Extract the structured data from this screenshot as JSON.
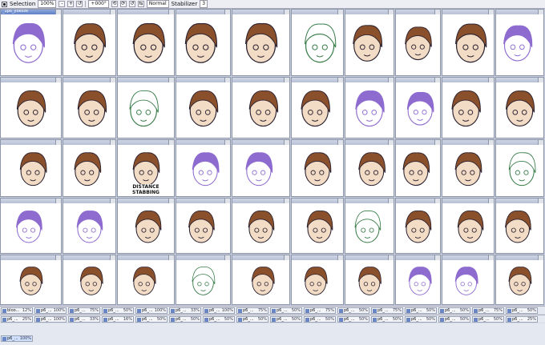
{
  "toolbar": {
    "selection_label": "Selection",
    "selection_checked": true,
    "zoom": "100%",
    "rotation": "+000°",
    "blend_mode": "Normal",
    "stabilizer_label": "Stabilizer",
    "stabilizer_value": "3"
  },
  "active_window_title": "_1p6_yokoze",
  "row1_tabs": [
    {
      "name": "bloo...",
      "zoom": "12%"
    },
    {
      "name": "p6_...",
      "zoom": "100%"
    },
    {
      "name": "p6_...",
      "zoom": "75%"
    },
    {
      "name": "p6_...",
      "zoom": "50%"
    },
    {
      "name": "p6_...",
      "zoom": "100%"
    },
    {
      "name": "p6_...",
      "zoom": "33%"
    },
    {
      "name": "p6_...",
      "zoom": "100%"
    },
    {
      "name": "p6_...",
      "zoom": "75%"
    },
    {
      "name": "p6_...",
      "zoom": "50%"
    },
    {
      "name": "p6_...",
      "zoom": "75%"
    },
    {
      "name": "p6_...",
      "zoom": "50%"
    },
    {
      "name": "p6_...",
      "zoom": "75%"
    },
    {
      "name": "p6_...",
      "zoom": "50%"
    },
    {
      "name": "p6_...",
      "zoom": "50%"
    },
    {
      "name": "p6_...",
      "zoom": "75%"
    },
    {
      "name": "p6_...",
      "zoom": "50%"
    }
  ],
  "row2_tabs": [
    {
      "name": "p6_...",
      "zoom": "25%"
    },
    {
      "name": "p6_...",
      "zoom": "100%"
    },
    {
      "name": "p6_...",
      "zoom": "33%"
    },
    {
      "name": "p6_...",
      "zoom": "16%"
    },
    {
      "name": "p6_...",
      "zoom": "50%"
    },
    {
      "name": "p6_...",
      "zoom": "50%"
    },
    {
      "name": "p6_...",
      "zoom": "50%"
    },
    {
      "name": "p6_...",
      "zoom": "50%"
    },
    {
      "name": "p6_...",
      "zoom": "50%"
    },
    {
      "name": "p6_...",
      "zoom": "50%"
    },
    {
      "name": "p6_...",
      "zoom": "50%"
    },
    {
      "name": "p6_...",
      "zoom": "50%"
    },
    {
      "name": "p6_...",
      "zoom": "50%"
    },
    {
      "name": "p6_...",
      "zoom": "50%"
    },
    {
      "name": "p6_...",
      "zoom": "50%"
    },
    {
      "name": "p6_...",
      "zoom": "25%"
    }
  ],
  "bottom_tab": {
    "name": "p6_...",
    "zoom": "100%"
  },
  "artwork_caption": "DISTANCE STABBING",
  "colors": {
    "hair": "#8a4f2b",
    "purple": "#8e6ccf",
    "skin": "#f3dcc6",
    "line": "#2a2230"
  }
}
